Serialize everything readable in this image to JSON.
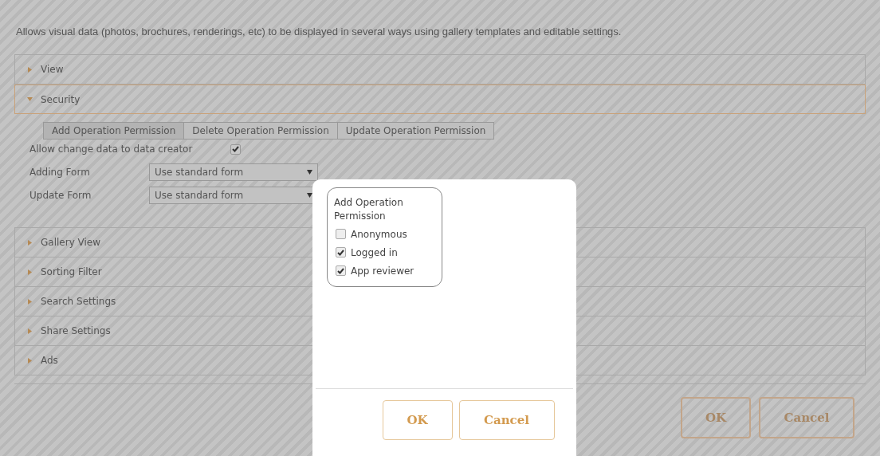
{
  "description": "Allows visual data (photos, brochures, renderings, etc) to be displayed in several ways using gallery templates and editable settings.",
  "sections": [
    {
      "title": "View",
      "expanded": false
    },
    {
      "title": "Security",
      "expanded": true
    },
    {
      "title": "Gallery View",
      "expanded": false
    },
    {
      "title": "Sorting Filter",
      "expanded": false
    },
    {
      "title": "Search Settings",
      "expanded": false
    },
    {
      "title": "Share Settings",
      "expanded": false
    },
    {
      "title": "Ads",
      "expanded": false
    }
  ],
  "security": {
    "tabs": [
      {
        "label": "Add Operation Permission",
        "selected": true
      },
      {
        "label": "Delete Operation Permission",
        "selected": false
      },
      {
        "label": "Update Operation Permission",
        "selected": false
      }
    ],
    "allow_change": {
      "label": "Allow change data to data creator",
      "checked": true
    },
    "fields": [
      {
        "label": "Adding Form",
        "value": "Use standard form"
      },
      {
        "label": "Update Form",
        "value": "Use standard form"
      }
    ]
  },
  "footer_buttons": [
    "OK",
    "Cancel"
  ],
  "dialog": {
    "legend": "Add Operation Permission",
    "options": [
      {
        "label": "Anonymous",
        "checked": false
      },
      {
        "label": "Logged in",
        "checked": true
      },
      {
        "label": "App reviewer",
        "checked": true
      }
    ],
    "buttons": [
      "OK",
      "Cancel"
    ]
  }
}
